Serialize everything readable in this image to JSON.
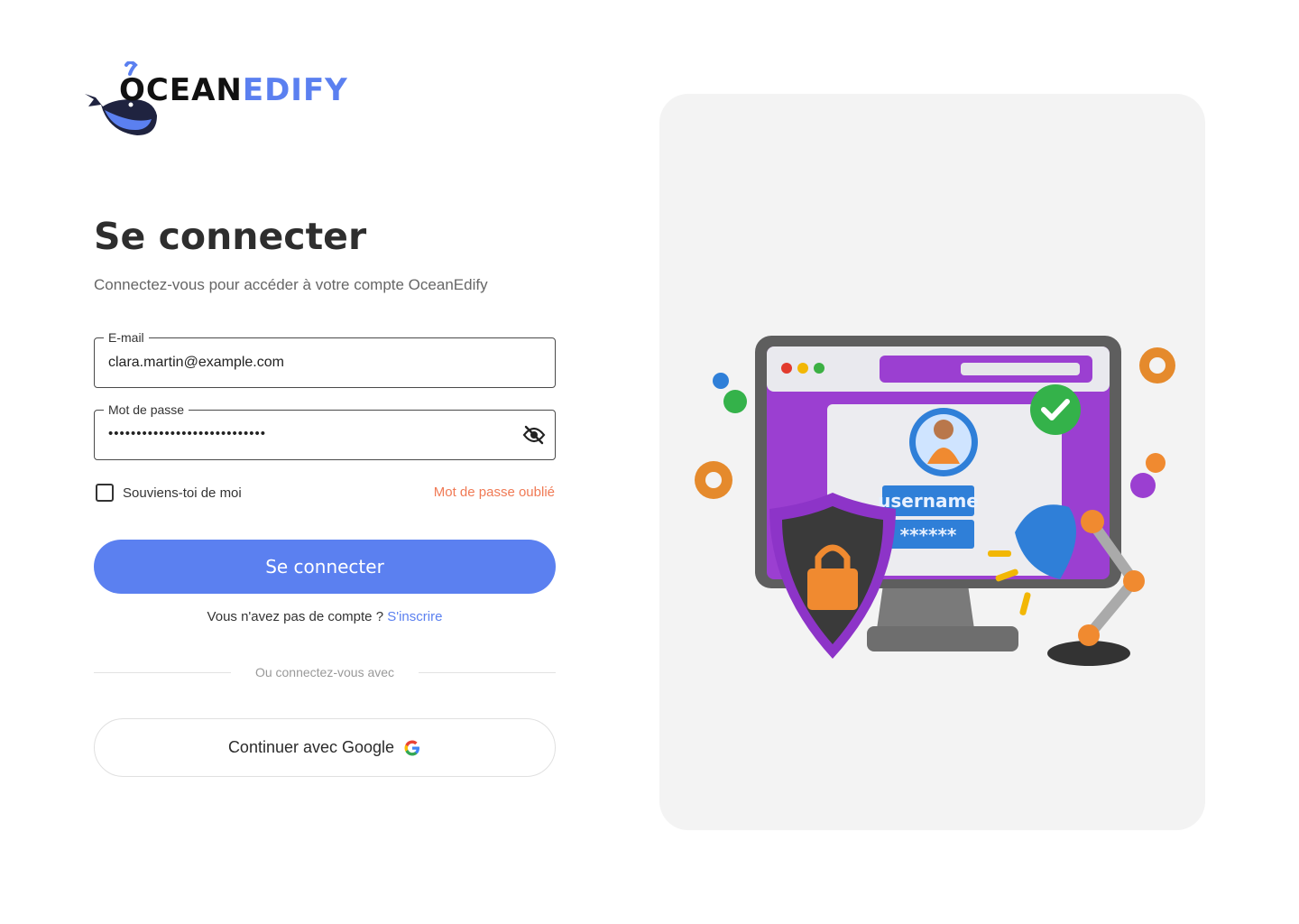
{
  "logo": {
    "part1": "OCEAN",
    "part2": "EDIFY"
  },
  "page": {
    "title": "Se connecter",
    "subtitle": "Connectez-vous pour accéder à votre compte OceanEdify"
  },
  "form": {
    "email": {
      "label": "E-mail",
      "value": "clara.martin@example.com"
    },
    "password": {
      "label": "Mot de passe",
      "masked_value": "••••••••••••••••••••••••••••"
    },
    "remember_label": "Souviens-toi de moi",
    "forgot_label": "Mot de passe oublié",
    "submit_label": "Se connecter"
  },
  "signup": {
    "prompt": "Vous n'avez pas de compte ?",
    "link": "S'inscrire"
  },
  "divider_text": "Ou connectez-vous avec",
  "google": {
    "label": "Continuer avec Google",
    "icon": "google-icon"
  },
  "illustration": {
    "username_text": "username",
    "password_text": "******"
  },
  "colors": {
    "primary": "#5b80f0",
    "accent_link": "#f07a55",
    "panel_bg": "#f3f3f3",
    "purple": "#9b3fd1"
  },
  "icons": {
    "visibility_toggle": "eye-off-icon",
    "logo_mark": "whale-icon"
  }
}
